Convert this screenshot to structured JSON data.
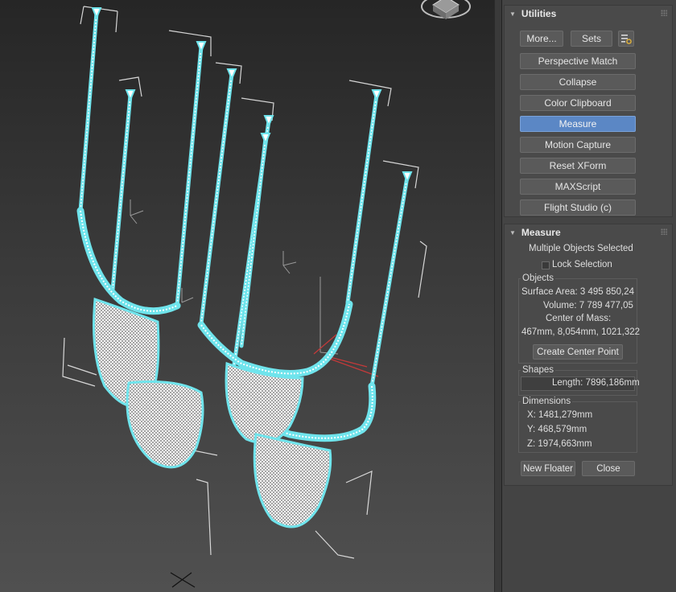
{
  "viewport": {
    "description_icon": "viewcube-icon"
  },
  "utilities": {
    "title": "Utilities",
    "more_label": "More...",
    "sets_label": "Sets",
    "config_icon": "configure-sets-icon",
    "buttons": [
      {
        "label": "Perspective Match",
        "active": false
      },
      {
        "label": "Collapse",
        "active": false
      },
      {
        "label": "Color Clipboard",
        "active": false
      },
      {
        "label": "Measure",
        "active": true
      },
      {
        "label": "Motion Capture",
        "active": false
      },
      {
        "label": "Reset XForm",
        "active": false
      },
      {
        "label": "MAXScript",
        "active": false
      },
      {
        "label": "Flight Studio (c)",
        "active": false
      }
    ]
  },
  "measure": {
    "title": "Measure",
    "selection_status": "Multiple Objects Selected",
    "lock_selection_label": "Lock Selection",
    "lock_selection_checked": false,
    "objects": {
      "title": "Objects",
      "surface_area": "Surface Area: 3 495 850,24",
      "volume": "Volume: 7 789 477,05",
      "center_of_mass_label": "Center of Mass:",
      "center_of_mass_value": "467mm, 8,054mm, 1021,322",
      "create_center_point_label": "Create Center Point"
    },
    "shapes": {
      "title": "Shapes",
      "length": "Length: 7896,186mm"
    },
    "dimensions": {
      "title": "Dimensions",
      "x": "X:   1481,279mm",
      "y": "Y:   468,579mm",
      "z": "Z:   1974,663mm"
    },
    "new_floater_label": "New Floater",
    "close_label": "Close"
  }
}
